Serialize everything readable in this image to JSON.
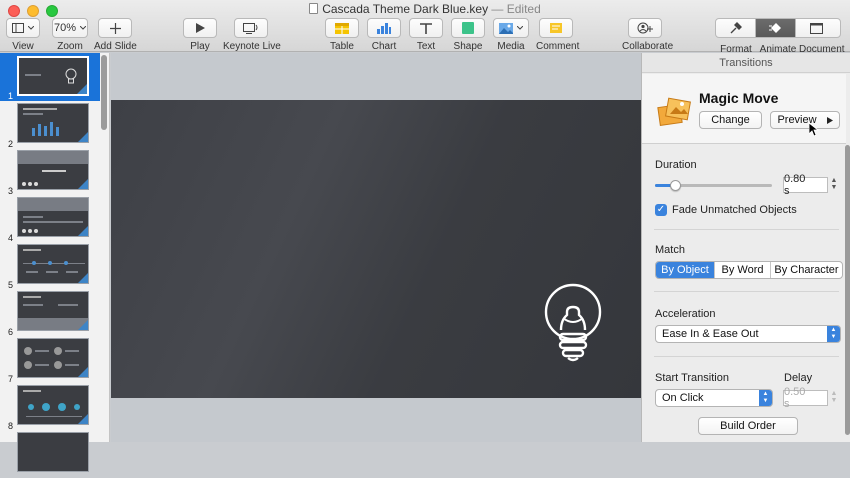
{
  "window": {
    "title": "Cascada Theme Dark Blue.key",
    "status": "— Edited"
  },
  "toolbar": {
    "view_label": "View",
    "zoom_value": "70%",
    "zoom_label": "Zoom",
    "add_slide_label": "Add Slide",
    "play_label": "Play",
    "keynote_live_label": "Keynote Live",
    "table_label": "Table",
    "chart_label": "Chart",
    "text_label": "Text",
    "shape_label": "Shape",
    "media_label": "Media",
    "comment_label": "Comment",
    "collaborate_label": "Collaborate",
    "format_label": "Format",
    "animate_label": "Animate",
    "document_label": "Document",
    "active_inspector": "Animate"
  },
  "navigator": {
    "selected_slide": 1,
    "slides": [
      {
        "number": "1"
      },
      {
        "number": "2"
      },
      {
        "number": "3"
      },
      {
        "number": "4"
      },
      {
        "number": "5"
      },
      {
        "number": "6"
      },
      {
        "number": "7"
      },
      {
        "number": "8"
      }
    ]
  },
  "slide": {
    "icon": "lightbulb-icon"
  },
  "inspector": {
    "header": "Transitions",
    "effect_name": "Magic Move",
    "change_button": "Change",
    "preview_button": "Preview",
    "duration_label": "Duration",
    "duration_value": "0.80 s",
    "duration_fraction": 0.17,
    "fade_label": "Fade Unmatched Objects",
    "fade_checked": true,
    "match_label": "Match",
    "match_options": [
      "By Object",
      "By Word",
      "By Character"
    ],
    "match_selected": "By Object",
    "acceleration_label": "Acceleration",
    "acceleration_value": "Ease In & Ease Out",
    "start_label": "Start Transition",
    "start_value": "On Click",
    "delay_label": "Delay",
    "delay_value": "0.50 s",
    "build_order_button": "Build Order"
  },
  "colors": {
    "accent": "#3a83dd",
    "slide_bg": "#3e4046",
    "selection": "#1a73d9"
  }
}
